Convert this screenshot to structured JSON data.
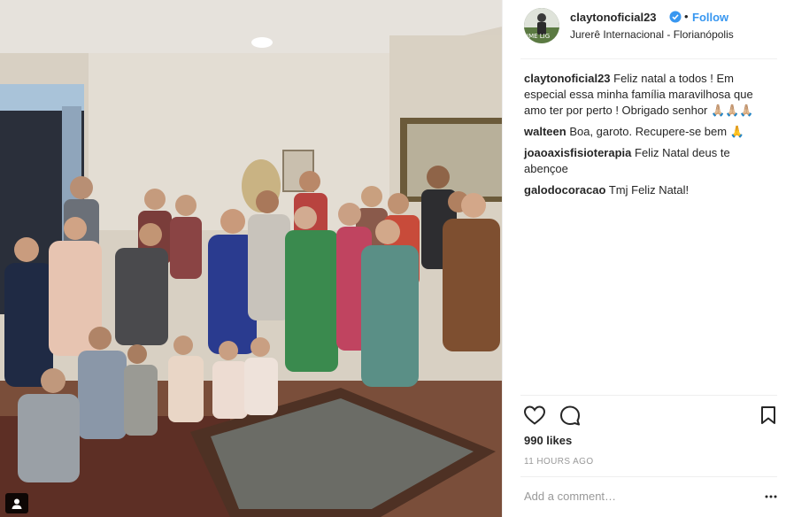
{
  "post": {
    "username": "claytonoficial23",
    "follow_label": "Follow",
    "separator": "•",
    "location": "Jurerê Internacional - Florianópolis",
    "avatar_text": "IME LIG"
  },
  "comments": [
    {
      "user": "claytonoficial23",
      "text": "Feliz natal a todos ! Em especial essa minha família maravilhosa que amo ter por perto ! Obrigado senhor 🙏🏼🙏🏼🙏🏼"
    },
    {
      "user": "walteen",
      "text": "Boa, garoto. Recupere-se bem 🙏"
    },
    {
      "user": "joaoaxisfisioterapia",
      "text": "Feliz Natal deus te abençoe"
    },
    {
      "user": "galodocoracao",
      "text": "Tmj Feliz Natal!"
    }
  ],
  "engagement": {
    "likes": "990 likes",
    "timestamp": "11 HOURS AGO"
  },
  "add_comment": {
    "placeholder": "Add a comment…"
  },
  "icons": {
    "verified": "verified-badge-icon",
    "like": "heart-icon",
    "comment": "comment-bubble-icon",
    "save": "bookmark-icon",
    "more": "more-options-icon",
    "user_tag": "user-tag-icon"
  },
  "colors": {
    "link": "#3897f0",
    "text": "#262626",
    "muted": "#999999"
  }
}
